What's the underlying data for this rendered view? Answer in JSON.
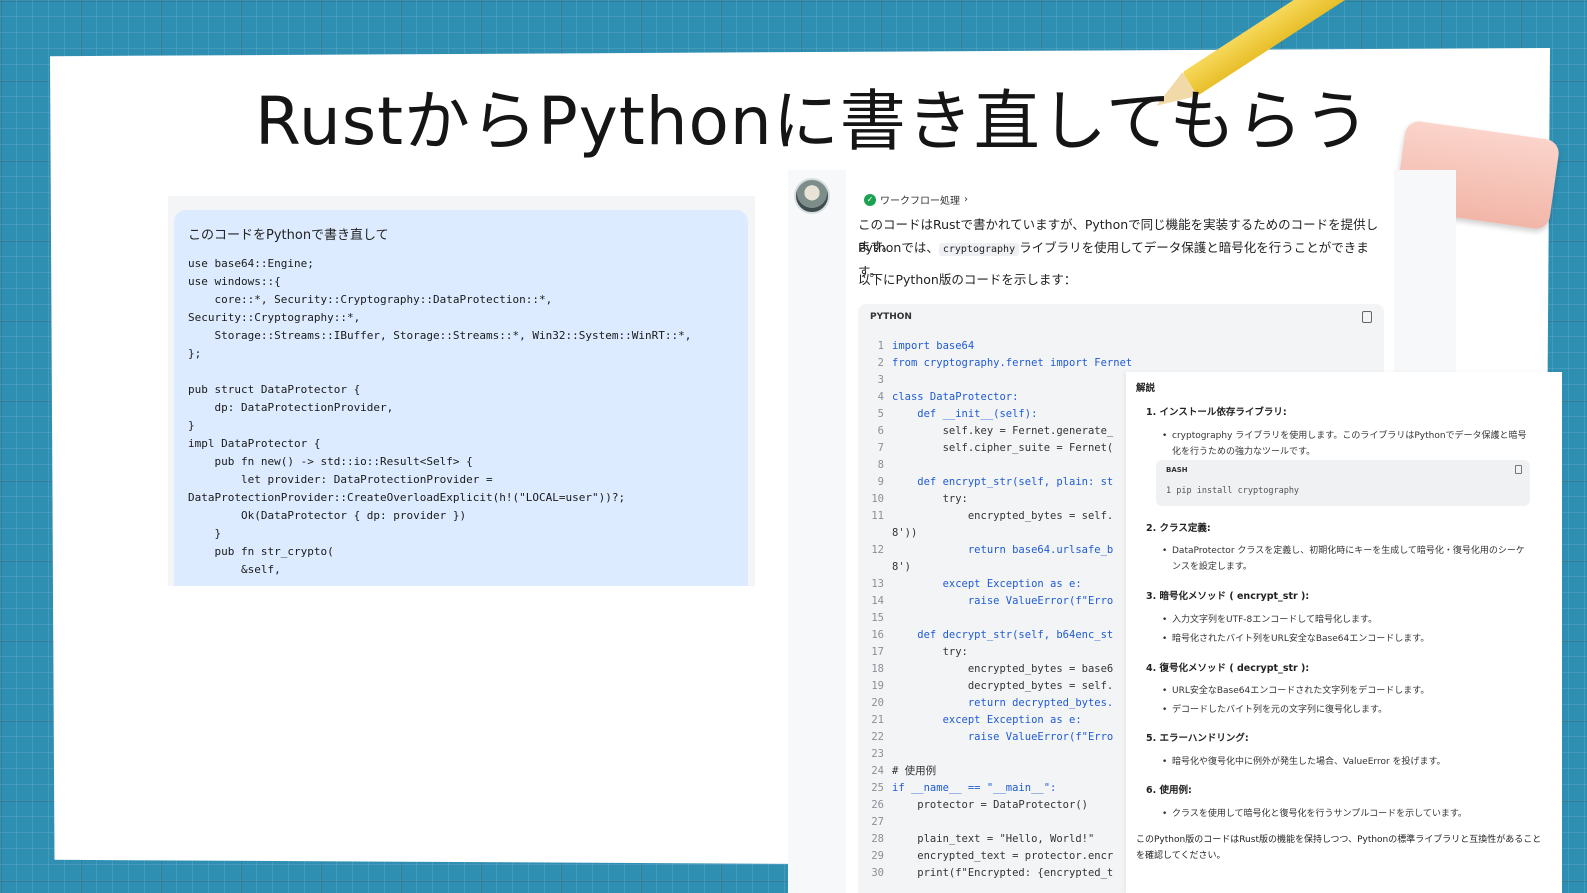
{
  "title": "RustからPythonに書き直してもらう",
  "user": {
    "prompt": "このコードをPythonで書き直して",
    "code": "use base64::Engine;\nuse windows::{\n    core::*, Security::Cryptography::DataProtection::*,\nSecurity::Cryptography::*,\n    Storage::Streams::IBuffer, Storage::Streams::*, Win32::System::WinRT::*,\n};\n\npub struct DataProtector {\n    dp: DataProtectionProvider,\n}\nimpl DataProtector {\n    pub fn new() -> std::io::Result<Self> {\n        let provider: DataProtectionProvider =\nDataProtectionProvider::CreateOverloadExplicit(h!(\"LOCAL=user\"))?;\n        Ok(DataProtector { dp: provider })\n    }\n    pub fn str_crypto(\n        &self,"
  },
  "ai": {
    "workflow": "ワークフロー処理",
    "intro1": "このコードはRustで書かれていますが、Pythonで同じ機能を実装するためのコードを提供します。",
    "intro2_a": "Pythonでは、",
    "intro2_code": "cryptography",
    "intro2_b": "ライブラリを使用してデータ保護と暗号化を行うことができます。",
    "intro3": "以下にPython版のコードを示します：",
    "code_lang": "PYTHON",
    "code_lines": [
      {
        "n": "1",
        "t": "import base64"
      },
      {
        "n": "2",
        "t": "from cryptography.fernet import Fernet"
      },
      {
        "n": "3",
        "t": ""
      },
      {
        "n": "4",
        "t": "class DataProtector:"
      },
      {
        "n": "5",
        "t": "    def __init__(self):"
      },
      {
        "n": "6",
        "t": "        self.key = Fernet.generate_"
      },
      {
        "n": "7",
        "t": "        self.cipher_suite = Fernet("
      },
      {
        "n": "8",
        "t": ""
      },
      {
        "n": "9",
        "t": "    def encrypt_str(self, plain: st"
      },
      {
        "n": "10",
        "t": "        try:"
      },
      {
        "n": "11",
        "t": "            encrypted_bytes = self."
      },
      {
        "n": "",
        "t": "8'))"
      },
      {
        "n": "12",
        "t": "            return base64.urlsafe_b"
      },
      {
        "n": "",
        "t": "8')"
      },
      {
        "n": "13",
        "t": "        except Exception as e:"
      },
      {
        "n": "14",
        "t": "            raise ValueError(f\"Erro"
      },
      {
        "n": "15",
        "t": ""
      },
      {
        "n": "16",
        "t": "    def decrypt_str(self, b64enc_st"
      },
      {
        "n": "17",
        "t": "        try:"
      },
      {
        "n": "18",
        "t": "            encrypted_bytes = base6"
      },
      {
        "n": "19",
        "t": "            decrypted_bytes = self."
      },
      {
        "n": "20",
        "t": "            return decrypted_bytes."
      },
      {
        "n": "21",
        "t": "        except Exception as e:"
      },
      {
        "n": "22",
        "t": "            raise ValueError(f\"Erro"
      },
      {
        "n": "23",
        "t": ""
      },
      {
        "n": "24",
        "t": "# 使用例"
      },
      {
        "n": "25",
        "t": "if __name__ == \"__main__\":"
      },
      {
        "n": "26",
        "t": "    protector = DataProtector()"
      },
      {
        "n": "27",
        "t": ""
      },
      {
        "n": "28",
        "t": "    plain_text = \"Hello, World!\""
      },
      {
        "n": "29",
        "t": "    encrypted_text = protector.encr"
      },
      {
        "n": "30",
        "t": "    print(f\"Encrypted: {encrypted_t"
      }
    ]
  },
  "explain": {
    "heading": "解説",
    "i1": "1. インストール依存ライブラリ:",
    "i1_b1": "cryptography ライブラリを使用します。このライブラリはPythonでデータ保護と暗号化を行うための強力なツールです。",
    "bash_lang": "BASH",
    "bash_code": "1  pip install cryptography",
    "i2": "2. クラス定義:",
    "i2_b1": "DataProtector クラスを定義し、初期化時にキーを生成して暗号化・復号化用のシーケンスを設定します。",
    "i3": "3. 暗号化メソッド ( encrypt_str ):",
    "i3_b1": "入力文字列をUTF-8エンコードして暗号化します。",
    "i3_b2": "暗号化されたバイト列をURL安全なBase64エンコードします。",
    "i4": "4. 復号化メソッド ( decrypt_str ):",
    "i4_b1": "URL安全なBase64エンコードされた文字列をデコードします。",
    "i4_b2": "デコードしたバイト列を元の文字列に復号化します。",
    "i5": "5. エラーハンドリング:",
    "i5_b1": "暗号化や復号化中に例外が発生した場合、ValueError を投げます。",
    "i6": "6. 使用例:",
    "i6_b1": "クラスを使用して暗号化と復号化を行うサンプルコードを示しています。",
    "footer": "このPython版のコードはRust版の機能を保持しつつ、Pythonの標準ライブラリと互換性があることを確認してください。"
  }
}
